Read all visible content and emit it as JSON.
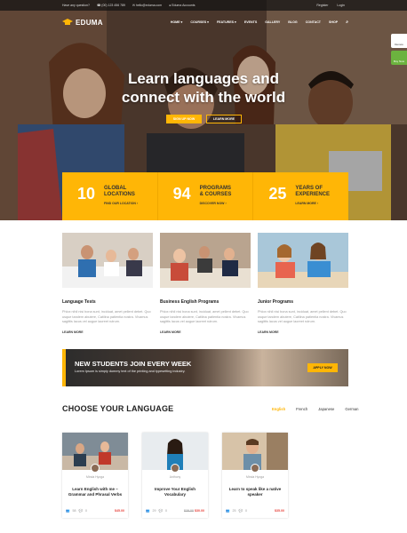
{
  "topbar": {
    "question": "Have any question?",
    "phone": "(00) 123 456 789",
    "email": "hello@eduma.com",
    "demo": "Eduma Accounts",
    "register": "Register",
    "login": "Login"
  },
  "brand": {
    "name": "EDUMA"
  },
  "nav": [
    "HOME ▾",
    "COURSES ▾",
    "FEATURES ▾",
    "EVENTS",
    "GALLERY",
    "BLOG",
    "CONTACT",
    "SHOP"
  ],
  "side_tabs": {
    "demos": "Demos",
    "buy": "Buy Now"
  },
  "hero": {
    "headline_line1": "Learn languages and",
    "headline_line2": "connect with the world",
    "btn_signup": "SIGN UP NOW",
    "btn_learn": "LEARN MORE"
  },
  "stats": [
    {
      "num": "10",
      "title_line1": "GLOBAL",
      "title_line2": "LOCATIONS",
      "link": "FIND OUR LOCATION ›"
    },
    {
      "num": "94",
      "title_line1": "PROGRAMS",
      "title_line2": "& COURSES",
      "link": "DISCOVER NOW ›"
    },
    {
      "num": "25",
      "title_line1": "YEARS OF",
      "title_line2": "EXPERIENCE",
      "link": "LEARN MORE ›"
    }
  ],
  "programs": [
    {
      "title": "Language Tests",
      "desc": "Phlox nihil nisi bona sunt, inciduat, amet pellent debet. Quo usque tandem abutere, Catilina patientia nostra. Vivamus sagittis lacus vel augue laoreet rutrum.",
      "more": "LEARN MORE"
    },
    {
      "title": "Business English Programs",
      "desc": "Phlox nihil nisi bona sunt, inciduat, amet pellent debet. Quo usque tandem abutere, Catilina patientia nostra. Vivamus sagittis lacus vel augue laoreet rutrum.",
      "more": "LEARN MORE"
    },
    {
      "title": "Junior Programs",
      "desc": "Phlox nihil nisi bona sunt, inciduat, amet pellent debet. Quo usque tandem abutere, Catilina patientia nostra. Vivamus sagittis lacus vel augue laoreet rutrum.",
      "more": "LEARN MORE"
    }
  ],
  "banner": {
    "title": "NEW STUDENTS JOIN EVERY WEEK",
    "sub": "Lorem Ipsum is simply dummy text of the printing and typesetting industry.",
    "button": "APPLY NOW"
  },
  "languages": {
    "heading": "CHOOSE YOUR LANGUAGE",
    "tabs": [
      "English",
      "French",
      "Japanese",
      "German"
    ]
  },
  "courses": [
    {
      "teacher": "Minda Hyoga",
      "title_line1": "Learn English with me –",
      "title_line2": "Grammar and Phrasal Verbs",
      "students": "58",
      "comments": "0",
      "old_price": "",
      "price": "$45.00"
    },
    {
      "teacher": "Anthony",
      "title_line1": "Improve Your English",
      "title_line2": "Vocabulary",
      "students": "29",
      "comments": "0",
      "old_price": "$39.00",
      "price": "$30.00"
    },
    {
      "teacher": "Minda Hyoga",
      "title_line1": "Learn to speak like a native",
      "title_line2": "speaker",
      "students": "25",
      "comments": "0",
      "old_price": "",
      "price": "$35.00"
    }
  ],
  "colors": {
    "accent": "#ffb606",
    "price": "#e7453f"
  }
}
